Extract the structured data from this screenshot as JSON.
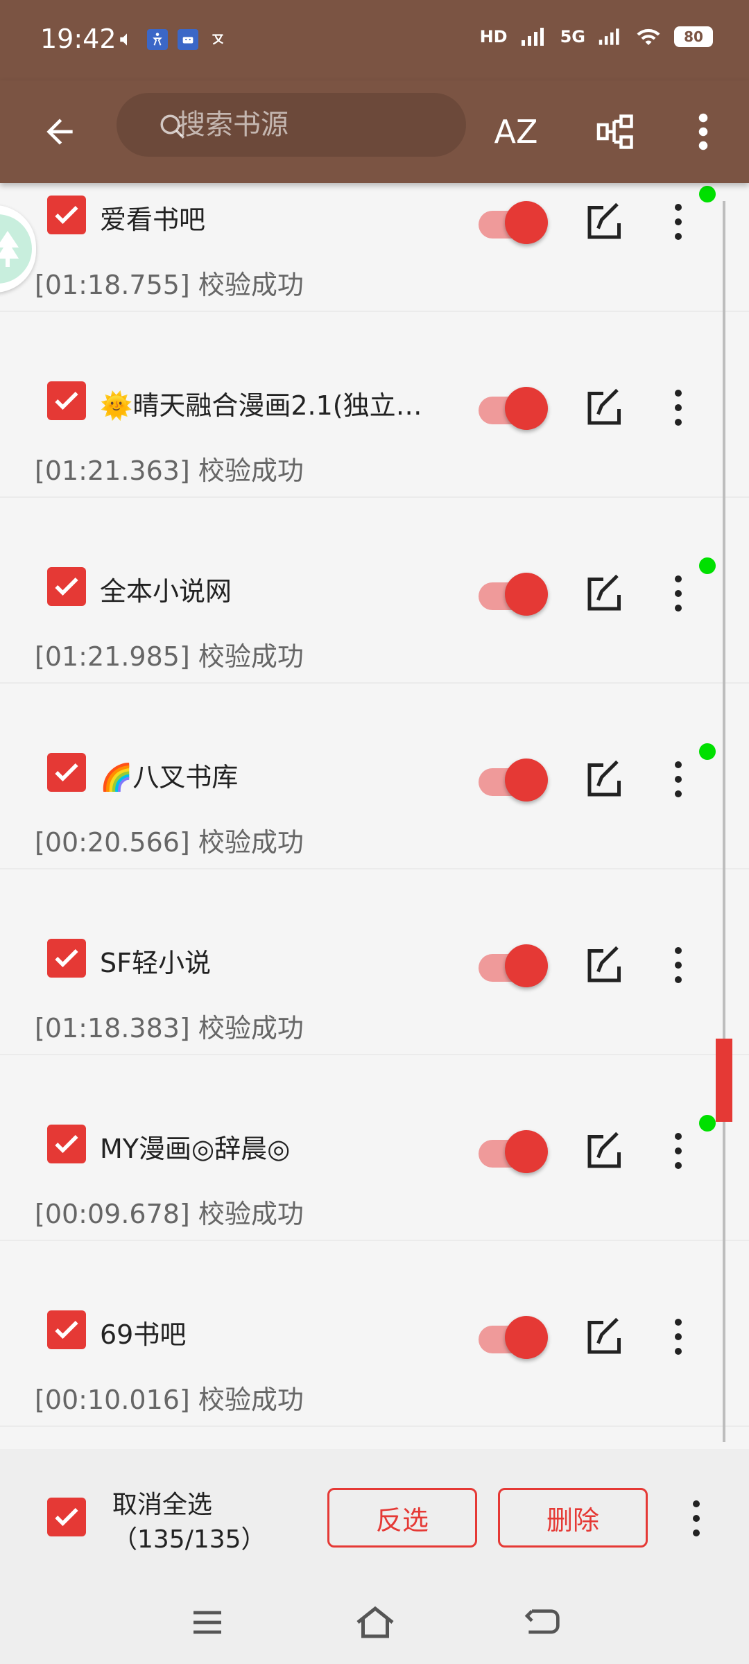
{
  "status_bar": {
    "time": "19:42",
    "left_icons": [
      "volume-icon",
      "accessibility-icon",
      "android-icon",
      "translate-icon"
    ],
    "network_label": "HD",
    "signal_label": "5G",
    "battery": "80"
  },
  "app_bar": {
    "search_placeholder": "搜索书源",
    "sort_label": "AZ",
    "icons": [
      "back-arrow-icon",
      "search-icon",
      "group-icon",
      "more-vert-icon"
    ]
  },
  "sources": [
    {
      "name": "爱看书吧",
      "status": "[01:18.755] 校验成功",
      "checked": true,
      "enabled": true,
      "green_dot": true
    },
    {
      "name": "🌞晴天融合漫画2.1(独立…",
      "status": "[01:21.363] 校验成功",
      "checked": true,
      "enabled": true,
      "green_dot": false
    },
    {
      "name": "全本小说网",
      "status": "[01:21.985] 校验成功",
      "checked": true,
      "enabled": true,
      "green_dot": true
    },
    {
      "name": "🌈八叉书库",
      "status": "[00:20.566] 校验成功",
      "checked": true,
      "enabled": true,
      "green_dot": true
    },
    {
      "name": "SF轻小说",
      "status": "[01:18.383] 校验成功",
      "checked": true,
      "enabled": true,
      "green_dot": false
    },
    {
      "name": "MY漫画◎辞晨◎",
      "status": "[00:09.678] 校验成功",
      "checked": true,
      "enabled": true,
      "green_dot": true
    },
    {
      "name": "69书吧",
      "status": "[00:10.016] 校验成功",
      "checked": true,
      "enabled": true,
      "green_dot": false
    }
  ],
  "bottom_bar": {
    "select_label": "取消全选",
    "count_label": "（135/135）",
    "invert_label": "反选",
    "delete_label": "删除"
  },
  "colors": {
    "primary": "#7b5443",
    "accent": "#e53935",
    "accent_light": "#ef9a9a",
    "ok_dot": "#00e000"
  }
}
